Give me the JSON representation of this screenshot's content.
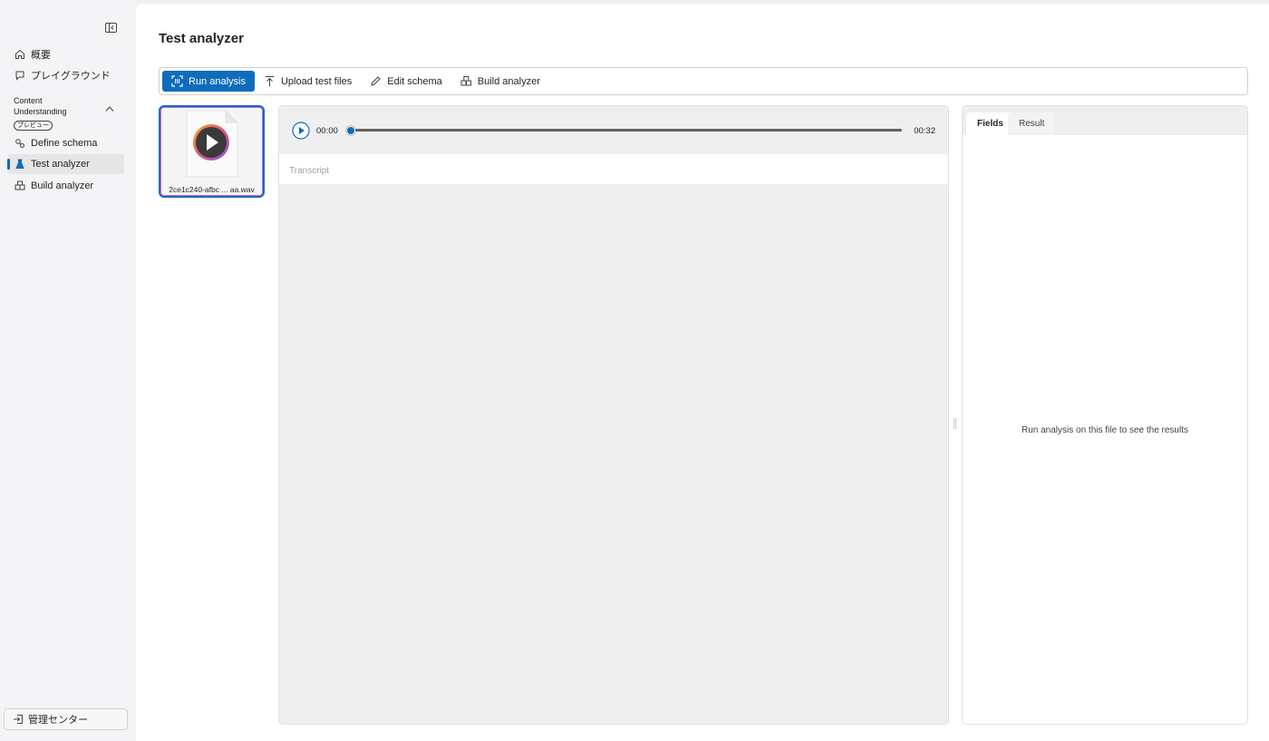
{
  "sidebar": {
    "items": [
      {
        "label": "概要",
        "icon": "home-icon"
      },
      {
        "label": "プレイグラウンド",
        "icon": "chat-icon"
      }
    ],
    "group": {
      "title": "Content Understanding",
      "badge": "プレビュー",
      "expanded": true,
      "items": [
        {
          "label": "Define schema",
          "icon": "schema-icon",
          "active": false
        },
        {
          "label": "Test analyzer",
          "icon": "beaker-icon",
          "active": true
        },
        {
          "label": "Build analyzer",
          "icon": "cubes-icon",
          "active": false
        }
      ]
    },
    "admin_label": "管理センター"
  },
  "page": {
    "title": "Test analyzer"
  },
  "toolbar": {
    "run_label": "Run analysis",
    "upload_label": "Upload test files",
    "edit_label": "Edit schema",
    "build_label": "Build analyzer"
  },
  "file": {
    "name": "2ce1c240-afbc-...-aa.wav",
    "display_name": "2ce1c240-afbc ... aa.wav"
  },
  "player": {
    "current_time": "00:00",
    "duration": "00:32",
    "progress": 0.0,
    "transcript_label": "Transcript"
  },
  "results": {
    "tabs": [
      {
        "label": "Fields",
        "active": true
      },
      {
        "label": "Result",
        "active": false
      }
    ],
    "empty_message": "Run analysis on this file to see the results"
  },
  "colors": {
    "accent": "#0f6cbd",
    "selection_glow": "#d25fe0",
    "sidebar_bg": "#f4f4f6"
  }
}
